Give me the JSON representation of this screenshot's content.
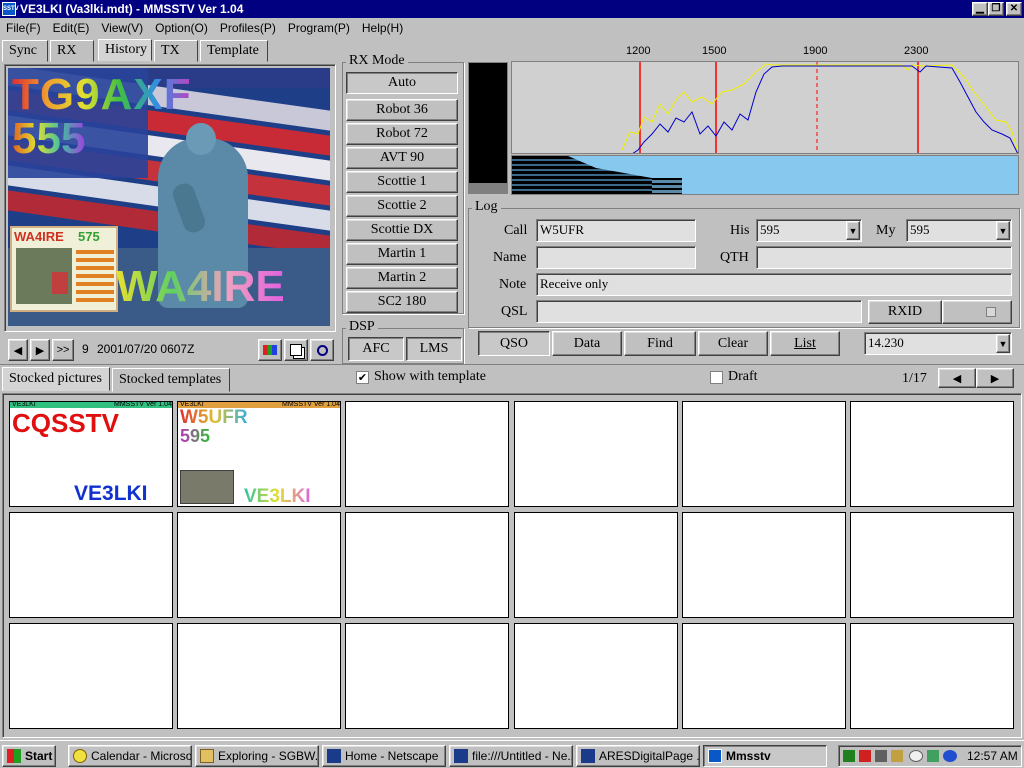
{
  "window": {
    "title": "VE3LKI (Va3lki.mdt) - MMSSTV Ver 1.04",
    "icon": "mmsstv-icon"
  },
  "menu": [
    "File(F)",
    "Edit(E)",
    "View(V)",
    "Option(O)",
    "Profiles(P)",
    "Program(P)",
    "Help(H)"
  ],
  "tabs": {
    "sync": "Sync",
    "rx": "RX",
    "history": "History",
    "tx": "TX",
    "template": "Template"
  },
  "rxpic": {
    "call": "TG9AXF",
    "report": "555",
    "thumb_call": "WA4IRE",
    "thumb_report": "575",
    "station": "WA4IRE"
  },
  "history_nav": {
    "first": "◀",
    "next": "▶",
    "last": ">>",
    "index": "9",
    "datetime": "2001/07/20 0607Z"
  },
  "rxmode": {
    "label": "RX Mode",
    "modes": [
      "Auto",
      "Robot 36",
      "Robot 72",
      "AVT 90",
      "Scottie 1",
      "Scottie 2",
      "Scottie DX",
      "Martin 1",
      "Martin 2",
      "SC2 180"
    ]
  },
  "dsp": {
    "label": "DSP",
    "afc": "AFC",
    "lms": "LMS"
  },
  "spectrum": {
    "ticks": [
      "1200",
      "1500",
      "1900",
      "2300"
    ]
  },
  "log": {
    "label": "Log",
    "call_label": "Call",
    "call_value": "W5UFR",
    "his_label": "His",
    "his_value": "595",
    "my_label": "My",
    "my_value": "595",
    "name_label": "Name",
    "name_value": "",
    "qth_label": "QTH",
    "qth_value": "",
    "note_label": "Note",
    "note_value": "Receive only",
    "qsl_label": "QSL",
    "qsl_value": "",
    "rxid": "RXID"
  },
  "actions": {
    "qso": "QSO",
    "data": "Data",
    "find": "Find",
    "clear": "Clear",
    "list": "List",
    "freq": "14.230"
  },
  "stock_tabs": {
    "pictures": "Stocked pictures",
    "templates": "Stocked templates"
  },
  "options": {
    "show_with_template": "Show with template",
    "show_checked": true,
    "draft": "Draft",
    "draft_checked": false,
    "page": "1/17"
  },
  "thumbs": {
    "t1": {
      "header": "VE3LKI",
      "header_right": "MMSSTV Ver 1.04",
      "line1": "CQSSTV",
      "sign": "VE3LKI"
    },
    "t2": {
      "header": "VE3LKI",
      "header_right": "MMSSTV Ver 1.04",
      "line1": "W5UFR",
      "line2": "595",
      "sign": "VE3LKI"
    }
  },
  "taskbar": {
    "start": "Start",
    "items": [
      "Calendar - Microsof...",
      "Exploring - SGBW...",
      "Home - Netscape",
      "file:///Untitled - Ne...",
      "ARESDigitalPage ...",
      "Mmsstv"
    ],
    "clock": "12:57 AM"
  },
  "colors": {
    "titlebar": "#000080",
    "face": "#c0c0c0",
    "waterfall": "#86c8ee",
    "spectrum_line": "#0000cc",
    "peak_line": "#f0f000",
    "marker": "#ff0000"
  }
}
